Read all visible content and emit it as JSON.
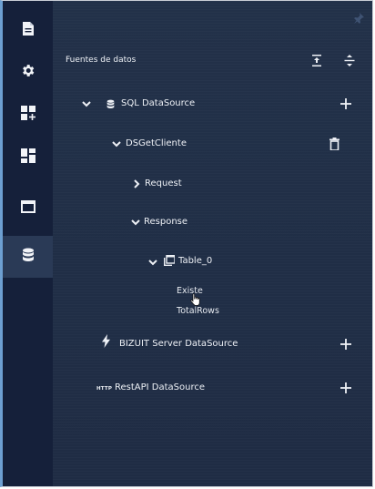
{
  "panel": {
    "title": "Fuentes de datos"
  },
  "tree": {
    "sql_datasource": "SQL DataSource",
    "dsgetcliente": "DSGetCliente",
    "request": "Request",
    "response": "Response",
    "table": "Table_0",
    "fields": [
      "Existe",
      "TotalRows"
    ],
    "bizuit_datasource": "BIZUIT Server DataSource",
    "rest_badge": "HTTP",
    "rest_datasource": "RestAPI DataSource"
  },
  "icons": {
    "rail": [
      "document-icon",
      "gear-icon",
      "add-widget-icon",
      "dashboard-icon",
      "window-icon",
      "database-icon"
    ],
    "pin": "pin-icon",
    "collapse_all": "collapse-all-icon",
    "expand_all": "expand-all-icon"
  },
  "colors": {
    "rail_bg": "#15203a",
    "panel_bg": "#223149",
    "rail_active": "#2a3a56",
    "accent_border": "#6d9fd1",
    "text": "#eef1f6"
  }
}
